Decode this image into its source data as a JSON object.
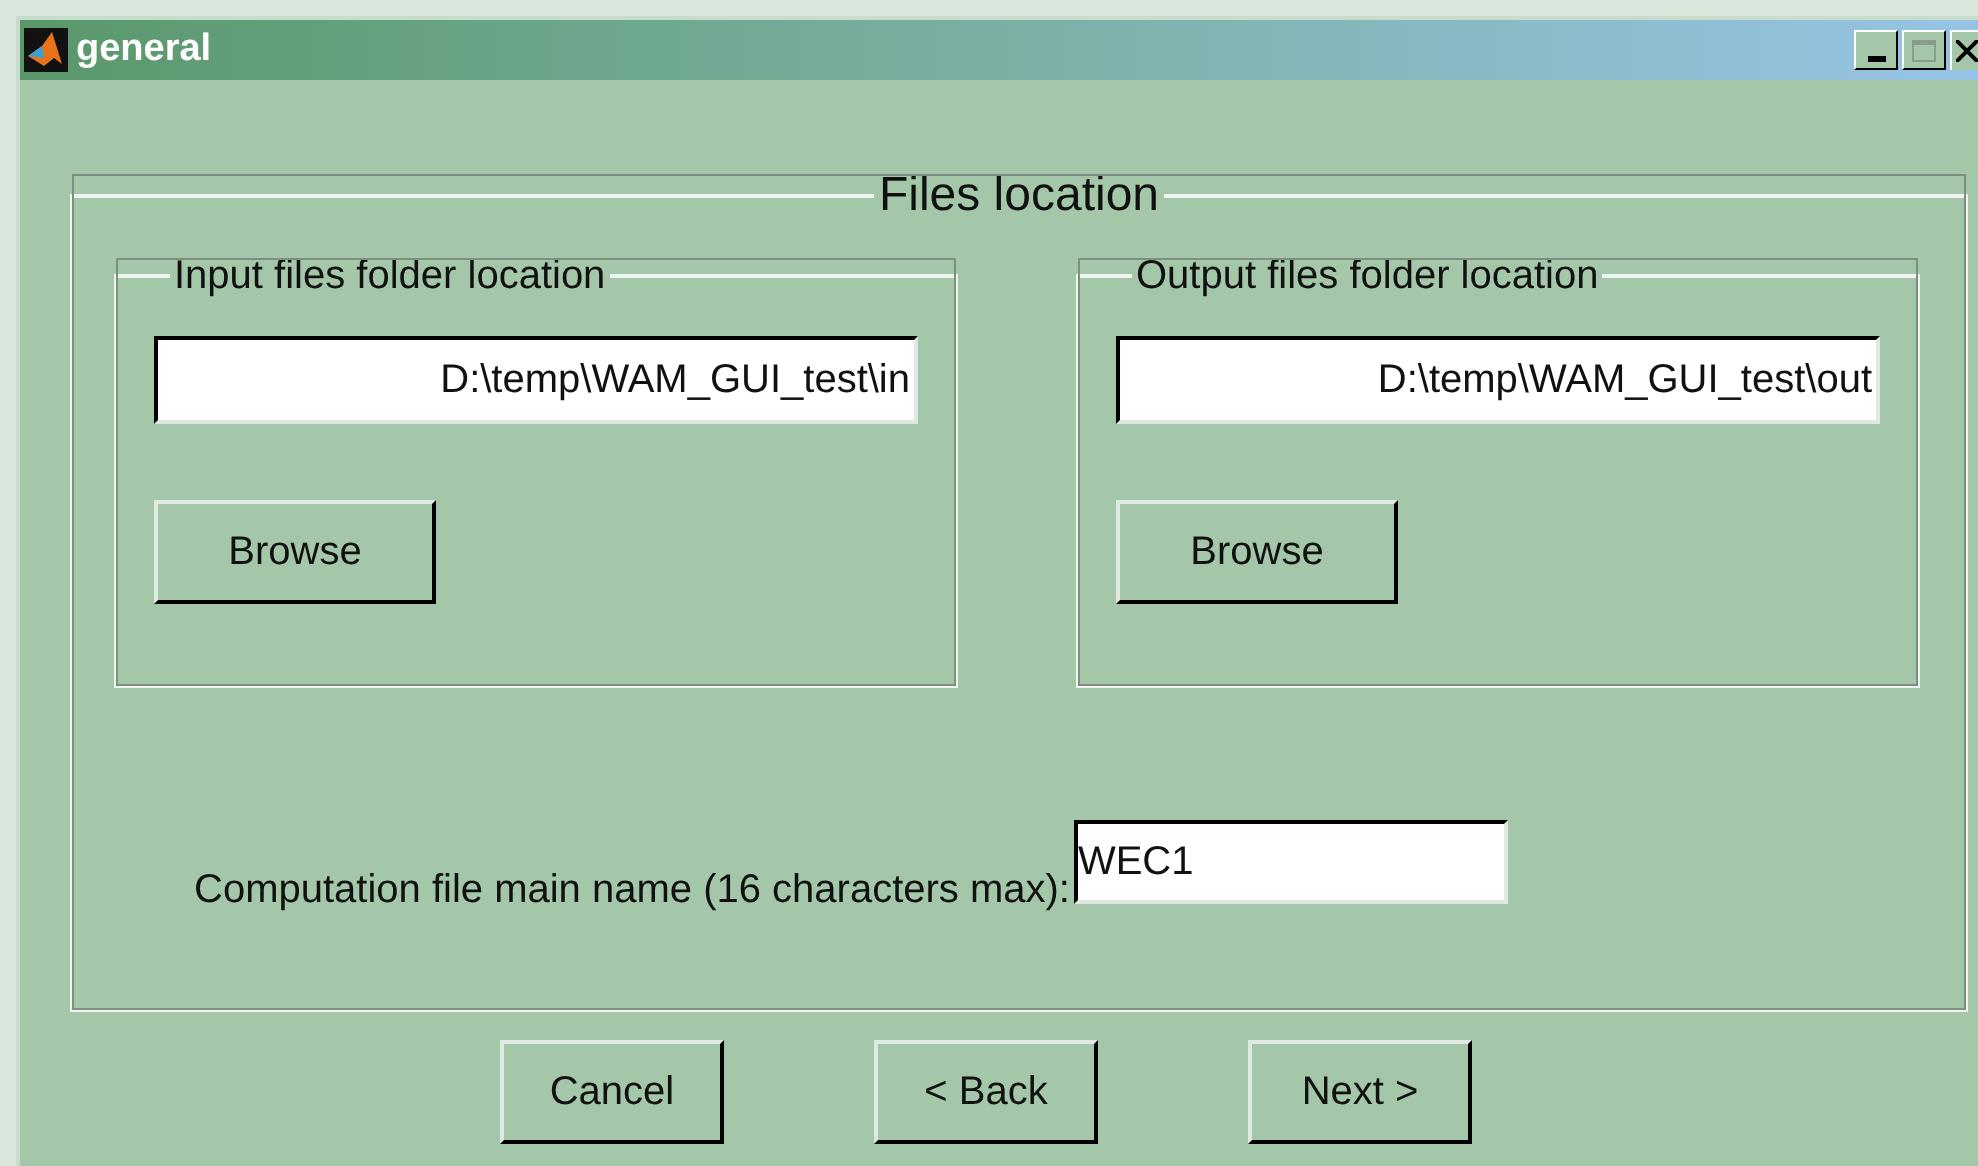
{
  "window": {
    "title": "general"
  },
  "panel": {
    "title": "Files location",
    "groups": [
      {
        "title": "Input files folder location",
        "path": "D:\\temp\\WAM_GUI_test\\in",
        "button": "Browse"
      },
      {
        "title": "Output files folder location",
        "path": "D:\\temp\\WAM_GUI_test\\out",
        "button": "Browse"
      }
    ],
    "name_label": "Computation file main name (16 characters max):",
    "name_value": "WEC1"
  },
  "buttons": [
    "Cancel",
    "< Back",
    "Next >"
  ]
}
